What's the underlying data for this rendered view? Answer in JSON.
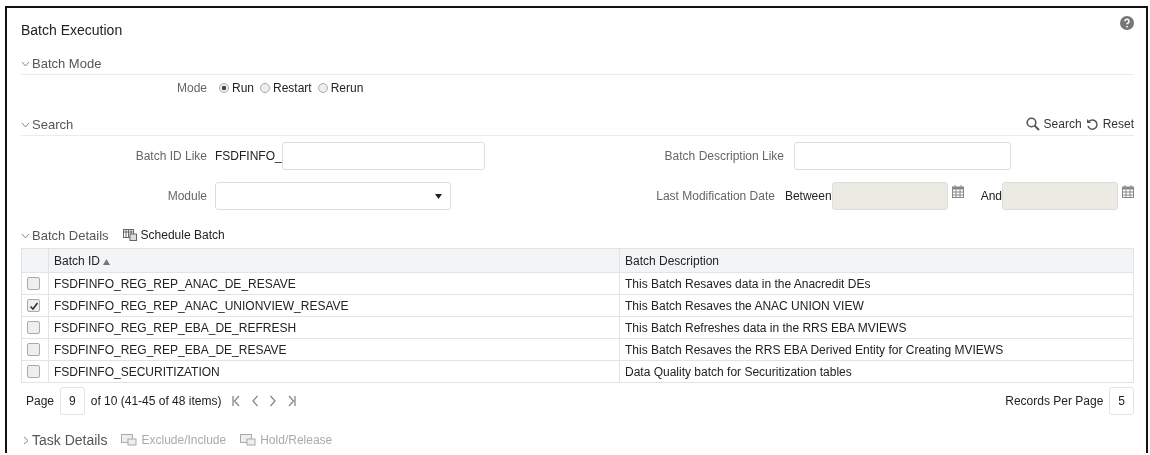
{
  "window": {
    "title": "Batch Execution"
  },
  "batch_mode": {
    "title": "Batch Mode",
    "expanded": true,
    "mode_label": "Mode",
    "options": [
      {
        "label": "Run",
        "selected": true
      },
      {
        "label": "Restart",
        "selected": false
      },
      {
        "label": "Rerun",
        "selected": false
      }
    ]
  },
  "search": {
    "title": "Search",
    "expanded": true,
    "actions": [
      {
        "kind": "search",
        "label": "Search"
      },
      {
        "kind": "reset",
        "label": "Reset"
      }
    ],
    "batch_id": {
      "label": "Batch ID Like",
      "prefix": "FSDFINFO_"
    },
    "batch_description": {
      "label": "Batch Description Like"
    },
    "module": {
      "label": "Module"
    },
    "last_modification": {
      "label": "Last Modification Date",
      "between": "Between",
      "and": "And"
    }
  },
  "batch_details": {
    "title": "Batch Details",
    "expanded": true,
    "toolbar": [
      "Schedule Batch"
    ],
    "table": {
      "columns": [
        {
          "label": "Batch ID",
          "sorted": true
        },
        {
          "label": "Batch Description",
          "sorted": false
        }
      ],
      "rows": [
        {
          "checked": false,
          "batch_id": "FSDFINFO_REG_REP_ANAC_DE_RESAVE",
          "description": "This Batch Resaves data in the Anacredit DEs"
        },
        {
          "checked": true,
          "batch_id": "FSDFINFO_REG_REP_ANAC_UNIONVIEW_RESAVE",
          "description": "This Batch Resaves the ANAC UNION VIEW"
        },
        {
          "checked": false,
          "batch_id": "FSDFINFO_REG_REP_EBA_DE_REFRESH",
          "description": "This Batch Refreshes data in the RRS EBA MVIEWS"
        },
        {
          "checked": false,
          "batch_id": "FSDFINFO_REG_REP_EBA_DE_RESAVE",
          "description": "This Batch Resaves the RRS EBA Derived Entity for Creating MVIEWS"
        },
        {
          "checked": false,
          "batch_id": "FSDFINFO_SECURITIZATION",
          "description": "Data Quality batch for Securitization tables"
        }
      ]
    },
    "pagination": {
      "page_label": "Page",
      "page": "9",
      "summary": "of 10 (41-45 of 48 items)",
      "records_label": "Records Per Page",
      "records": "5"
    }
  },
  "task_details": {
    "title": "Task Details",
    "expanded": false,
    "actions": [
      {
        "label": "Exclude/Include",
        "disabled": true
      },
      {
        "label": "Hold/Release",
        "disabled": true
      }
    ]
  }
}
